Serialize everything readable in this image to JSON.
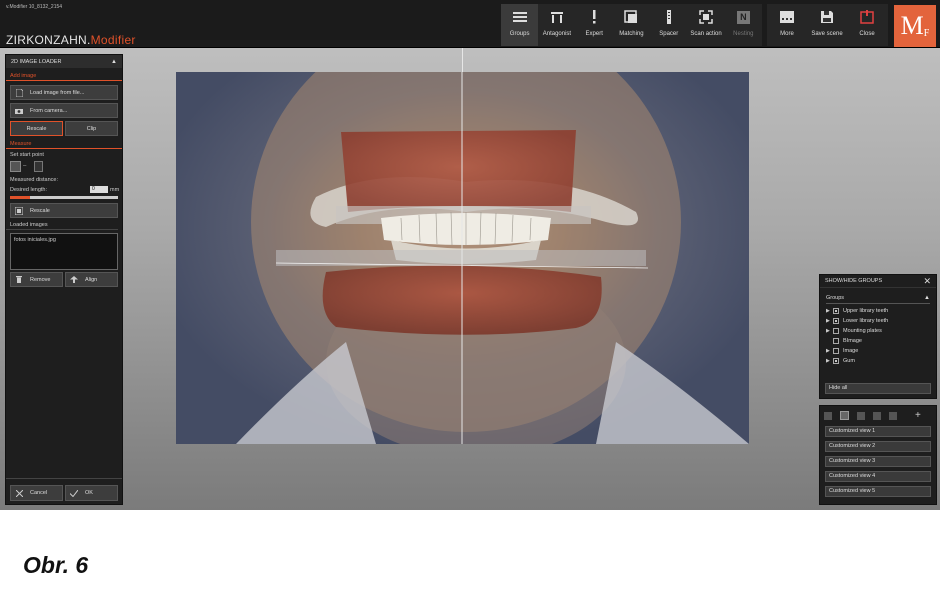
{
  "app": {
    "build": "v.Modifier 10_8132_2154",
    "brand_a": "ZIRKONZAHN.",
    "brand_b": "Modifier",
    "logo_main": "M",
    "logo_sub": "F"
  },
  "toolbar": {
    "groups": "Groups",
    "antagonist": "Antagonist",
    "expert": "Expert",
    "matching": "Matching",
    "spacer": "Spacer",
    "scan_action": "Scan action",
    "nesting": "Nesting",
    "more": "More",
    "save_scene": "Save scene",
    "close": "Close",
    "nesting_icon_letter": "N"
  },
  "left_panel": {
    "title": "2D IMAGE LOADER",
    "add_image": "Add image",
    "load_file": "Load image from file...",
    "from_camera": "From camera...",
    "rescale": "Rescale",
    "clip": "Clip",
    "measure": "Measure",
    "set_start": "Set start point",
    "measured_distance": "Measured distance:",
    "desired_length": "Desired length:",
    "desired_value": "0",
    "unit": "mm",
    "rescale2": "Rescale",
    "loaded_images": "Loaded images",
    "file_name": "fotos iniciales.jpg",
    "remove": "Remove",
    "align": "Align",
    "cancel": "Cancel",
    "ok": "OK"
  },
  "groups_panel": {
    "title": "SHOW/HIDE GROUPS",
    "groups_label": "Groups",
    "items": [
      {
        "label": "Upper library teeth",
        "checked": true,
        "expandable": true
      },
      {
        "label": "Lower library teeth",
        "checked": true,
        "expandable": true
      },
      {
        "label": "Mounting plates",
        "checked": false,
        "expandable": true
      },
      {
        "label": "BImage",
        "checked": false,
        "expandable": false
      },
      {
        "label": "Image",
        "checked": false,
        "expandable": true
      },
      {
        "label": "Gum",
        "checked": true,
        "expandable": true
      }
    ],
    "hide_all": "Hide all"
  },
  "views_panel": {
    "views": [
      "Customized view 1",
      "Customized view 2",
      "Customized view 3",
      "Customized view 4",
      "Customized view 5"
    ]
  },
  "caption": "Obr. 6",
  "colors": {
    "accent": "#e0522a",
    "logo_bg": "#e3643c",
    "close_red": "#e04040",
    "panel_bg": "#1e1e1e"
  }
}
